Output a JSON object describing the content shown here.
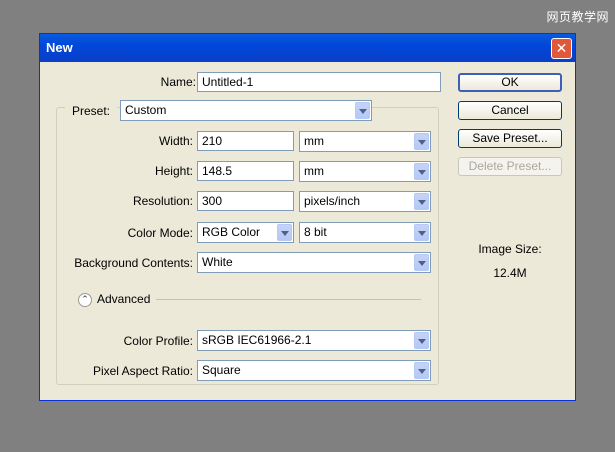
{
  "watermark": "网页教学网",
  "dialog": {
    "title": "New",
    "close_glyph": "✕"
  },
  "form": {
    "name_label": "Name:",
    "name_value": "Untitled-1",
    "preset_label": "Preset:",
    "preset_value": "Custom",
    "width_label": "Width:",
    "width_value": "210",
    "width_unit": "mm",
    "height_label": "Height:",
    "height_value": "148.5",
    "height_unit": "mm",
    "resolution_label": "Resolution:",
    "resolution_value": "300",
    "resolution_unit": "pixels/inch",
    "color_mode_label": "Color Mode:",
    "color_mode_value": "RGB Color",
    "bit_depth_value": "8 bit",
    "background_label": "Background Contents:",
    "background_value": "White",
    "advanced_label": "Advanced",
    "advanced_icon": "⌃",
    "color_profile_label": "Color Profile:",
    "color_profile_value": "sRGB IEC61966-2.1",
    "pixel_aspect_label": "Pixel Aspect Ratio:",
    "pixel_aspect_value": "Square"
  },
  "buttons": {
    "ok": "OK",
    "cancel": "Cancel",
    "save_preset": "Save Preset...",
    "delete_preset": "Delete Preset..."
  },
  "image_size": {
    "label": "Image Size:",
    "value": "12.4M"
  }
}
